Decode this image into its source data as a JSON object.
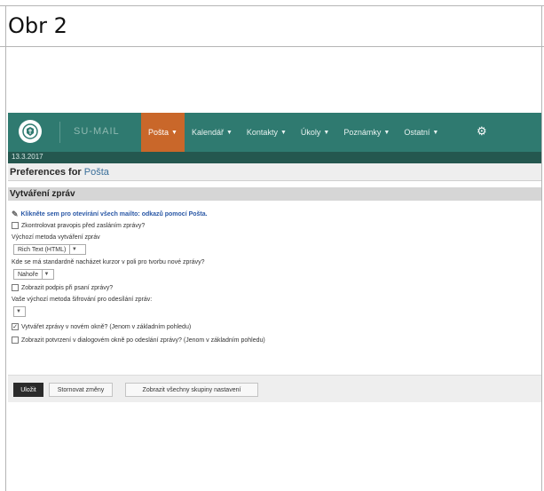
{
  "doc": {
    "title": "Obr 2"
  },
  "app": {
    "brand": "SU-MAIL",
    "nav": [
      {
        "label": "Pošta",
        "active": true
      },
      {
        "label": "Kalendář",
        "active": false
      },
      {
        "label": "Kontakty",
        "active": false
      },
      {
        "label": "Úkoly",
        "active": false
      },
      {
        "label": "Poznámky",
        "active": false
      },
      {
        "label": "Ostatní",
        "active": false
      }
    ],
    "caret": "▼",
    "date": "13.3.2017",
    "gear_icon": "gear-icon"
  },
  "prefs": {
    "title_prefix": "Preferences for",
    "title_app": "Pošta",
    "section": "Vytváření zpráv"
  },
  "options": {
    "link_text": "Klikněte sem pro otevírání všech mailto: odkazů pomocí Pošta.",
    "spellcheck": "Zkontrolovat pravopis před zasláním zprávy?",
    "compose_method_label": "Výchozí metoda vytváření zpráv",
    "compose_method_value": "Rich Text (HTML)",
    "cursor_label": "Kde se má standardně nacházet kurzor v poli pro tvorbu nové zprávy?",
    "cursor_value": "Nahoře",
    "signature": "Zobrazit podpis při psaní zprávy?",
    "encryption_label": "Vaše výchozí metoda šifrování pro odesílání zpráv:",
    "encryption_value": "",
    "new_window": "Vytvářet zprávy v novém okně? (Jenom v základním pohledu)",
    "new_window_checked": true,
    "confirm": "Zobrazit potvrzení v dialogovém okně po odeslání zprávy? (Jenom v základním pohledu)"
  },
  "buttons": {
    "save": "Uložit",
    "undo": "Stornovat změny",
    "show_all": "Zobrazit všechny skupiny nastavení"
  },
  "colors": {
    "topbar": "#2f7a70",
    "active_tab": "#c9672a",
    "datebar": "#24574f"
  }
}
